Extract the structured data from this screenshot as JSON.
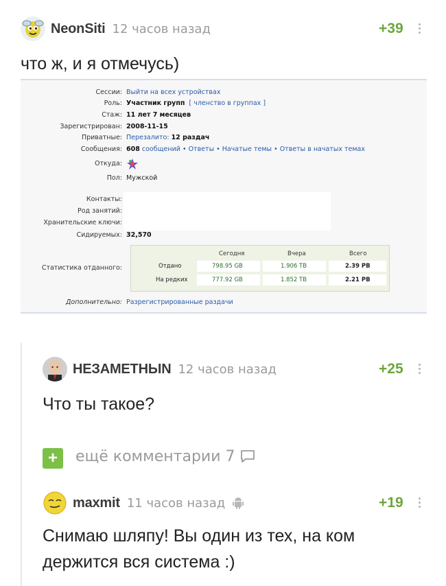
{
  "comments": [
    {
      "nick": "NeonSiti",
      "time": "12 часов назад",
      "rating": "+39",
      "text": "что ж, и я отмечусь)"
    },
    {
      "nick": "НЕЗАМЕТНЫN",
      "time": "12 часов назад",
      "rating": "+25",
      "text": "Что ты такое?"
    },
    {
      "nick": "maxmit",
      "time": "11 часов назад",
      "rating": "+19",
      "text_line1": "Снимаю шляпу! Вы один из тех, на ком",
      "text_line2": "держится вся система :)"
    }
  ],
  "more_comments": {
    "plus": "+",
    "label": "ещё комментарии 7"
  },
  "profile": {
    "sessions_label": "Сессии:",
    "sessions_value": "Выйти на всех устройствах",
    "role_label": "Роль:",
    "role_value": "Участник групп",
    "role_link": "[ членство в группах ]",
    "stazh_label": "Стаж:",
    "stazh_value": "11 лет 7 месяцев",
    "registered_label": "Зарегистрирован:",
    "registered_value": "2008-11-15",
    "private_label": "Приватные:",
    "private_value_prefix": "Перезалито:",
    "private_value": "12 раздач",
    "messages_label": "Сообщения:",
    "messages_count": "608",
    "messages_links": "сообщений • Ответы • Начатые темы • Ответы в начатых темах",
    "from_label": "Откуда:",
    "sex_label": "Пол:",
    "sex_value": "Мужской",
    "contacts_label": "Контакты:",
    "occupation_label": "Род занятий:",
    "keys_label": "Хранительские ключи:",
    "seeding_label": "Сидируемых:",
    "seeding_value": "32,570",
    "stats_label": "Статистика отданного:",
    "stats_headers": [
      "Сегодня",
      "Вчера",
      "Всего"
    ],
    "stats_rows": [
      {
        "name": "Отдано",
        "today": "798.95 GB",
        "yesterday": "1.906 TB",
        "total": "2.39 PB"
      },
      {
        "name": "На редких",
        "today": "777.92 GB",
        "yesterday": "1.852 TB",
        "total": "2.21 PB"
      }
    ],
    "extra_label": "Дополнительно:",
    "extra_value": "Разрегистрированные раздачи"
  },
  "colors": {
    "rating_green": "#6ba73c",
    "more_button": "#7cc048",
    "link_blue": "#2a5aa8"
  }
}
